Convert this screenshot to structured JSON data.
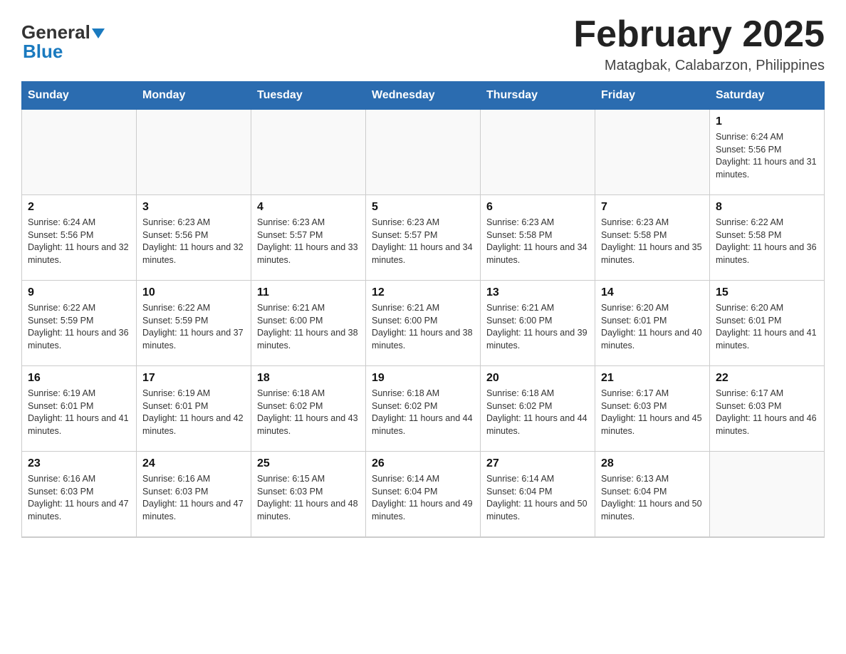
{
  "logo": {
    "general": "General",
    "blue": "Blue"
  },
  "header": {
    "title": "February 2025",
    "subtitle": "Matagbak, Calabarzon, Philippines"
  },
  "weekdays": [
    "Sunday",
    "Monday",
    "Tuesday",
    "Wednesday",
    "Thursday",
    "Friday",
    "Saturday"
  ],
  "weeks": [
    [
      {
        "day": "",
        "info": ""
      },
      {
        "day": "",
        "info": ""
      },
      {
        "day": "",
        "info": ""
      },
      {
        "day": "",
        "info": ""
      },
      {
        "day": "",
        "info": ""
      },
      {
        "day": "",
        "info": ""
      },
      {
        "day": "1",
        "info": "Sunrise: 6:24 AM\nSunset: 5:56 PM\nDaylight: 11 hours and 31 minutes."
      }
    ],
    [
      {
        "day": "2",
        "info": "Sunrise: 6:24 AM\nSunset: 5:56 PM\nDaylight: 11 hours and 32 minutes."
      },
      {
        "day": "3",
        "info": "Sunrise: 6:23 AM\nSunset: 5:56 PM\nDaylight: 11 hours and 32 minutes."
      },
      {
        "day": "4",
        "info": "Sunrise: 6:23 AM\nSunset: 5:57 PM\nDaylight: 11 hours and 33 minutes."
      },
      {
        "day": "5",
        "info": "Sunrise: 6:23 AM\nSunset: 5:57 PM\nDaylight: 11 hours and 34 minutes."
      },
      {
        "day": "6",
        "info": "Sunrise: 6:23 AM\nSunset: 5:58 PM\nDaylight: 11 hours and 34 minutes."
      },
      {
        "day": "7",
        "info": "Sunrise: 6:23 AM\nSunset: 5:58 PM\nDaylight: 11 hours and 35 minutes."
      },
      {
        "day": "8",
        "info": "Sunrise: 6:22 AM\nSunset: 5:58 PM\nDaylight: 11 hours and 36 minutes."
      }
    ],
    [
      {
        "day": "9",
        "info": "Sunrise: 6:22 AM\nSunset: 5:59 PM\nDaylight: 11 hours and 36 minutes."
      },
      {
        "day": "10",
        "info": "Sunrise: 6:22 AM\nSunset: 5:59 PM\nDaylight: 11 hours and 37 minutes."
      },
      {
        "day": "11",
        "info": "Sunrise: 6:21 AM\nSunset: 6:00 PM\nDaylight: 11 hours and 38 minutes."
      },
      {
        "day": "12",
        "info": "Sunrise: 6:21 AM\nSunset: 6:00 PM\nDaylight: 11 hours and 38 minutes."
      },
      {
        "day": "13",
        "info": "Sunrise: 6:21 AM\nSunset: 6:00 PM\nDaylight: 11 hours and 39 minutes."
      },
      {
        "day": "14",
        "info": "Sunrise: 6:20 AM\nSunset: 6:01 PM\nDaylight: 11 hours and 40 minutes."
      },
      {
        "day": "15",
        "info": "Sunrise: 6:20 AM\nSunset: 6:01 PM\nDaylight: 11 hours and 41 minutes."
      }
    ],
    [
      {
        "day": "16",
        "info": "Sunrise: 6:19 AM\nSunset: 6:01 PM\nDaylight: 11 hours and 41 minutes."
      },
      {
        "day": "17",
        "info": "Sunrise: 6:19 AM\nSunset: 6:01 PM\nDaylight: 11 hours and 42 minutes."
      },
      {
        "day": "18",
        "info": "Sunrise: 6:18 AM\nSunset: 6:02 PM\nDaylight: 11 hours and 43 minutes."
      },
      {
        "day": "19",
        "info": "Sunrise: 6:18 AM\nSunset: 6:02 PM\nDaylight: 11 hours and 44 minutes."
      },
      {
        "day": "20",
        "info": "Sunrise: 6:18 AM\nSunset: 6:02 PM\nDaylight: 11 hours and 44 minutes."
      },
      {
        "day": "21",
        "info": "Sunrise: 6:17 AM\nSunset: 6:03 PM\nDaylight: 11 hours and 45 minutes."
      },
      {
        "day": "22",
        "info": "Sunrise: 6:17 AM\nSunset: 6:03 PM\nDaylight: 11 hours and 46 minutes."
      }
    ],
    [
      {
        "day": "23",
        "info": "Sunrise: 6:16 AM\nSunset: 6:03 PM\nDaylight: 11 hours and 47 minutes."
      },
      {
        "day": "24",
        "info": "Sunrise: 6:16 AM\nSunset: 6:03 PM\nDaylight: 11 hours and 47 minutes."
      },
      {
        "day": "25",
        "info": "Sunrise: 6:15 AM\nSunset: 6:03 PM\nDaylight: 11 hours and 48 minutes."
      },
      {
        "day": "26",
        "info": "Sunrise: 6:14 AM\nSunset: 6:04 PM\nDaylight: 11 hours and 49 minutes."
      },
      {
        "day": "27",
        "info": "Sunrise: 6:14 AM\nSunset: 6:04 PM\nDaylight: 11 hours and 50 minutes."
      },
      {
        "day": "28",
        "info": "Sunrise: 6:13 AM\nSunset: 6:04 PM\nDaylight: 11 hours and 50 minutes."
      },
      {
        "day": "",
        "info": ""
      }
    ]
  ]
}
